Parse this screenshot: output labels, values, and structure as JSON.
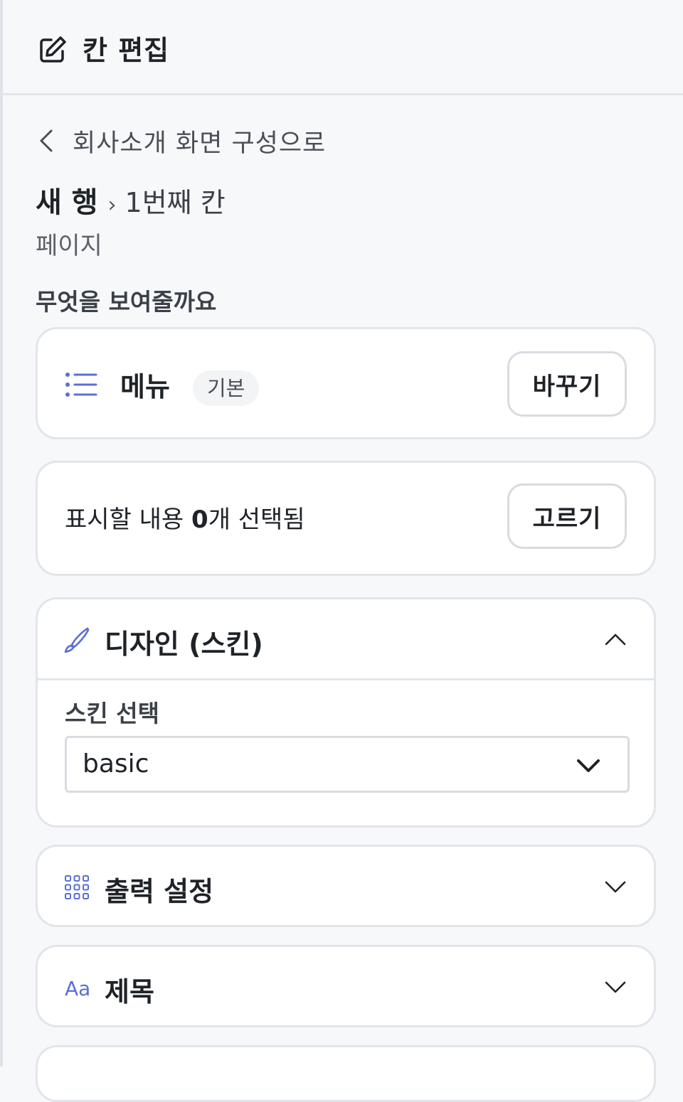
{
  "header": {
    "title": "칸 편집",
    "icon": "edit-icon"
  },
  "back_link": {
    "label": "회사소개 화면 구성으로",
    "icon": "chevron-left-icon"
  },
  "breadcrumb": {
    "row": "새 행",
    "separator": "›",
    "column": "1번째 칸"
  },
  "page_label": "페이지",
  "question": "무엇을 보여줄까요",
  "content_type": {
    "name": "메뉴",
    "badge": "기본",
    "change_label": "바꾸기",
    "icon": "list-icon"
  },
  "selection": {
    "prefix": "표시할 내용 ",
    "count": "0",
    "suffix": "개 선택됨",
    "choose_label": "고르기"
  },
  "design": {
    "title": "디자인 (스킨)",
    "icon": "brush-icon",
    "expanded": true,
    "skin_label": "스킨 선택",
    "skin_value": "basic"
  },
  "output": {
    "title": "출력 설정",
    "icon": "grid-icon",
    "expanded": false
  },
  "title_section": {
    "title": "제목",
    "icon_text": "Aa",
    "expanded": false
  },
  "colors": {
    "accent": "#5b6fd6",
    "border": "#e2e5e9",
    "background": "#f7f8fa"
  }
}
